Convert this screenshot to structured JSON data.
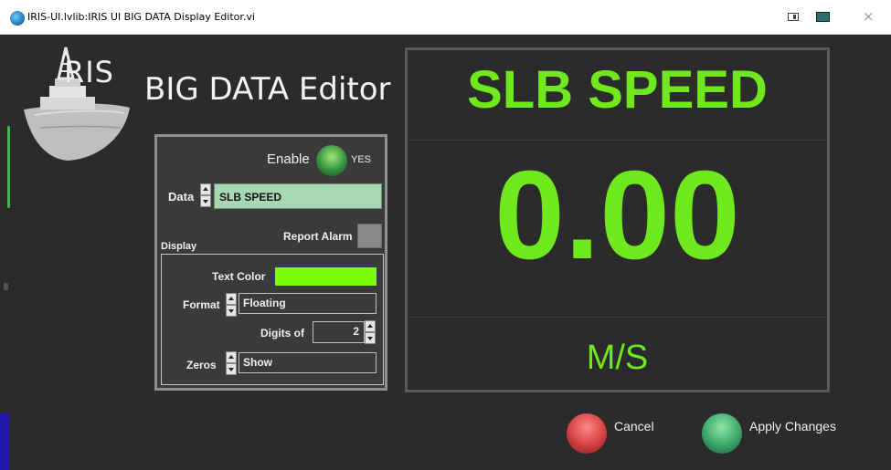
{
  "window": {
    "title": "IRIS-UI.lvlib:IRIS UI BIG DATA Display Editor.vi",
    "close_glyph": "×"
  },
  "header": {
    "logo_text": "RIS",
    "title": "BIG DATA Editor"
  },
  "controls": {
    "enable_label": "Enable",
    "enable_value": "YES",
    "data_label": "Data",
    "data_value": "SLB SPEED",
    "report_alarm_label": "Report Alarm",
    "display_label": "Display",
    "text_color_label": "Text Color",
    "text_color": "#7cfc0a",
    "format_label": "Format",
    "format_value": "Floating",
    "digits_label": "Digits of",
    "digits_value": "2",
    "zeros_label": "Zeros",
    "zeros_value": "Show"
  },
  "preview": {
    "title": "SLB SPEED",
    "value": "0.00",
    "unit": "M/S",
    "color": "#6fe81d"
  },
  "buttons": {
    "cancel_label": "Cancel",
    "apply_label": "Apply Changes"
  },
  "icons": [
    "app-icon",
    "panel-icon",
    "monitor-icon",
    "close-icon",
    "iris-logo-icon",
    "led-icon",
    "spinner-icon"
  ]
}
